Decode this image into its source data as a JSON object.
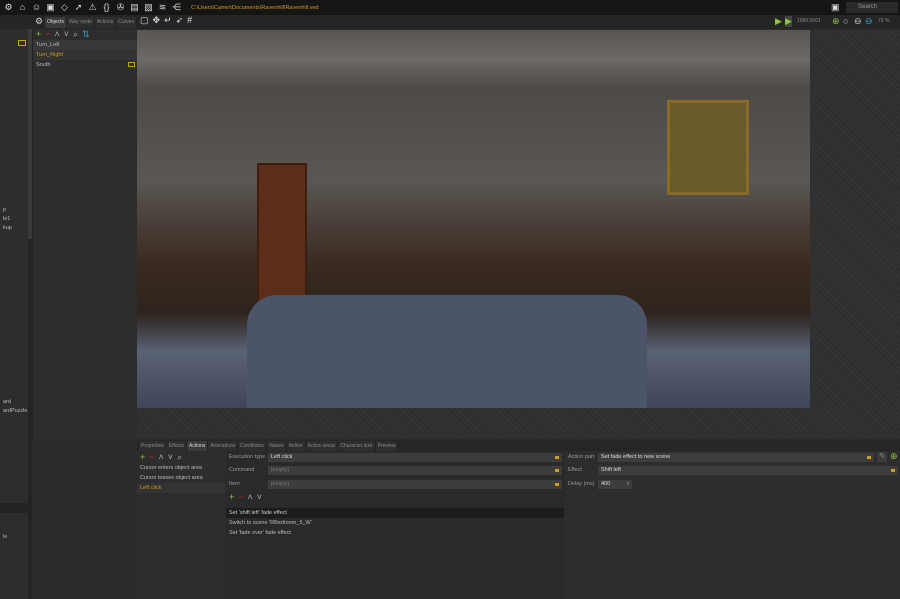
{
  "toolbar": {
    "path": "C:\\Users\\Camer\\Documents\\Ravenhill\\Ravenhill.ved",
    "search_placeholder": "Search",
    "coords": "1990,5661",
    "zoom": "79 %",
    "icons": [
      "gear-icon",
      "home-icon",
      "user-icon",
      "save-icon",
      "gem-icon",
      "cursor-icon",
      "warning-icon",
      "braces-icon",
      "film-icon",
      "chat-icon",
      "hatch-icon",
      "waveform-icon",
      "share-icon"
    ]
  },
  "left_panel": {
    "items": [
      "p",
      "le1",
      "kup",
      "ard",
      "ardPuzzle",
      "le"
    ]
  },
  "object_tabs": [
    "Objects",
    "Way syste",
    "Actions",
    "Curves"
  ],
  "objects": [
    {
      "label": "Turn_Left"
    },
    {
      "label": "Turn_Right",
      "selected": true
    },
    {
      "label": "South"
    }
  ],
  "bottom_tabs": [
    "Properties",
    "Effects",
    "Actions",
    "Animations",
    "Conditions",
    "Values",
    "Action",
    "Action areas",
    "Character size",
    "Preview"
  ],
  "action_triggers": [
    {
      "label": "Cursor enters object area"
    },
    {
      "label": "Cursor leaves object area"
    },
    {
      "label": "Left click",
      "selected": true
    }
  ],
  "execution": {
    "execution_type_label": "Execution type",
    "execution_type": "Left click",
    "command_label": "Command",
    "command": "[empty]",
    "item_label": "Item",
    "item": "[empty]"
  },
  "action_parts": [
    {
      "label": "Set 'shift left' fade effect",
      "selected": true
    },
    {
      "label": "Switch to scene 'RBedroom_5_W'"
    },
    {
      "label": "Set 'fade over' fade effect"
    }
  ],
  "action_part": {
    "label": "Action part",
    "value": "Set fade effect to new scene",
    "effect_label": "Effect",
    "effect": "Shift left",
    "delay_label": "Delay (ms)",
    "delay": "400"
  },
  "colors": {
    "accent": "#d49a1c",
    "add": "#8dc63f",
    "remove": "#dd2222"
  }
}
